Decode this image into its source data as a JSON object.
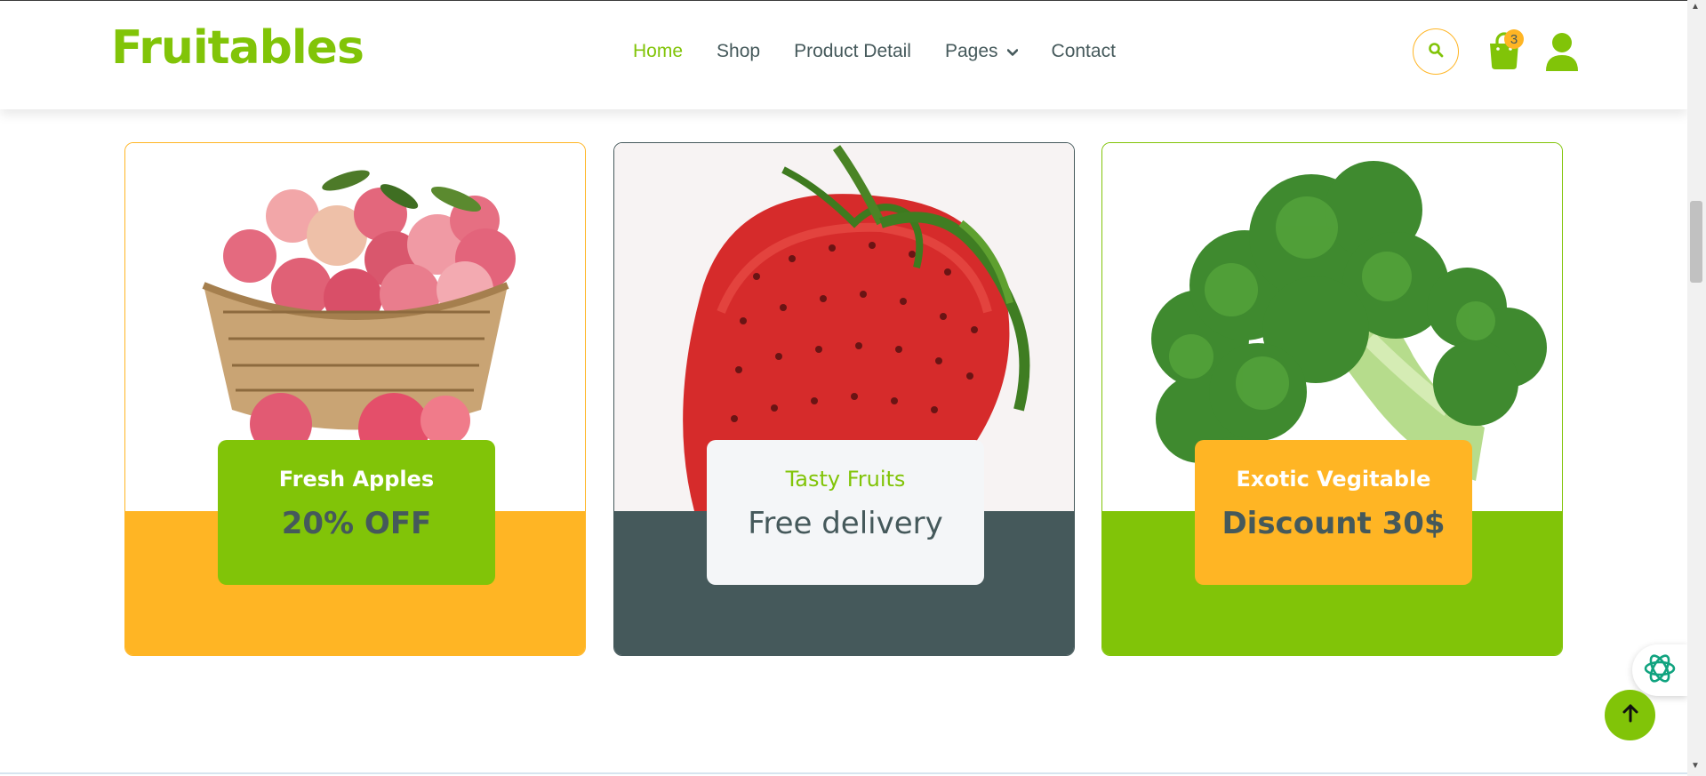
{
  "header": {
    "brand": "Fruitables",
    "nav": [
      {
        "label": "Home",
        "active": true
      },
      {
        "label": "Shop",
        "active": false
      },
      {
        "label": "Product Detail",
        "active": false
      },
      {
        "label": "Pages",
        "active": false,
        "has_dropdown": true
      },
      {
        "label": "Contact",
        "active": false
      }
    ],
    "cart_count": "3",
    "icons": [
      "search-icon",
      "shopping-bag-icon",
      "user-icon",
      "chevron-down-icon"
    ]
  },
  "cards": [
    {
      "image": "apple-basket-image",
      "title": "Fresh Apples",
      "subtitle": "20% OFF"
    },
    {
      "image": "strawberry-image",
      "title": "Tasty Fruits",
      "subtitle": "Free delivery"
    },
    {
      "image": "broccoli-image",
      "title": "Exotic Vegitable",
      "subtitle": "Discount 30$"
    }
  ],
  "floating": {
    "back_to_top_icon": "arrow-up-icon",
    "extension_icon": "ai-assistant-icon"
  },
  "colors": {
    "brand_green": "#81c408",
    "accent_orange": "#ffb524",
    "slate": "#45595b",
    "light": "#f4f6f8"
  }
}
